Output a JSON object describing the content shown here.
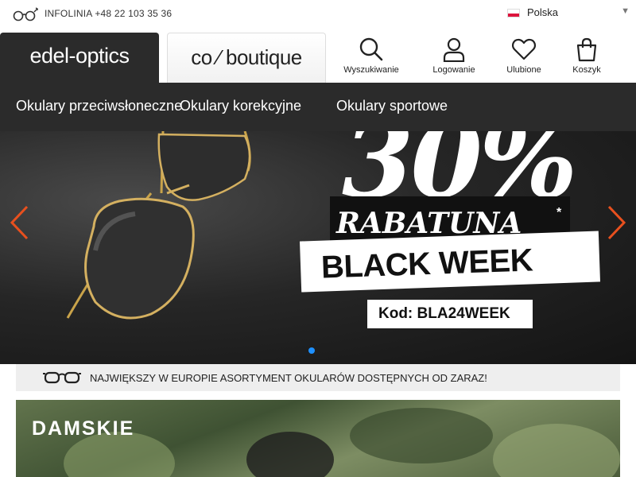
{
  "topbar": {
    "hotline": "INFOLINIA +48 22 103 35 36",
    "language": "Polska"
  },
  "brands": {
    "edel": "edel-optics",
    "co": "co ⁄ boutique"
  },
  "actions": {
    "search": "Wyszukiwanie",
    "login": "Logowanie",
    "favorites": "Ulubione",
    "cart": "Koszyk"
  },
  "nav": {
    "items": [
      "Okulary przeciwsłoneczne",
      "Okulary korekcyjne",
      "Okulary sportowe"
    ]
  },
  "hero": {
    "percent": "30%",
    "rabat": "RABATUNA",
    "asterisk": "*",
    "event": "BLACK WEEK",
    "code": "Kod: BLA24WEEK"
  },
  "strip": {
    "text": "NAJWIĘKSZY W EUROPIE ASORTYMENT OKULARÓW DOSTĘPNYCH OD ZARAZ!"
  },
  "category": {
    "title": "DAMSKIE"
  },
  "colors": {
    "dark": "#2b2b2b",
    "accent_arrow": "#e8501e",
    "dot_active": "#1e90ff"
  }
}
